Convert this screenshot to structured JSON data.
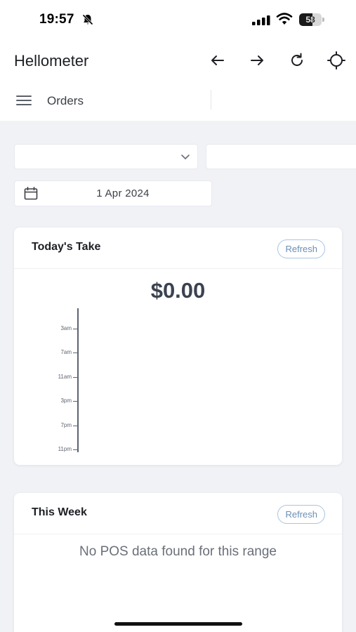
{
  "status_bar": {
    "time": "19:57",
    "battery_level": "58",
    "battery_fraction": 0.58
  },
  "header": {
    "title": "Hellometer",
    "icons": [
      "back-arrow-icon",
      "forward-arrow-icon",
      "reload-icon",
      "crosshair-icon"
    ]
  },
  "sub_nav": {
    "title": "Orders"
  },
  "filters": {
    "location_select_value": "",
    "second_select_value": "",
    "date_value": "1 Apr 2024"
  },
  "todays_take": {
    "title": "Today's Take",
    "refresh_label": "Refresh",
    "amount": "$0.00",
    "chart_data": {
      "type": "bar",
      "orientation": "horizontal",
      "categories": [
        "3am",
        "7am",
        "11am",
        "3pm",
        "7pm",
        "11pm"
      ],
      "values": [
        0,
        0,
        0,
        0,
        0,
        0
      ],
      "title": "",
      "xlabel": "",
      "ylabel": "",
      "grid": false
    }
  },
  "this_week": {
    "title": "This Week",
    "refresh_label": "Refresh",
    "empty_message": "No POS data found for this range"
  }
}
